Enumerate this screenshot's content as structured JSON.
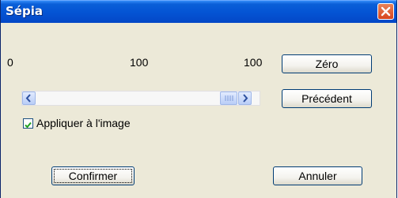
{
  "window": {
    "title": "Sépia"
  },
  "slider": {
    "min_label": "0",
    "mid_label": "100",
    "value_label": "100"
  },
  "buttons": {
    "zero": "Zéro",
    "previous": "Précédent",
    "confirm": "Confirmer",
    "cancel": "Annuler"
  },
  "checkbox": {
    "label": "Appliquer à l'image",
    "checked": true
  }
}
